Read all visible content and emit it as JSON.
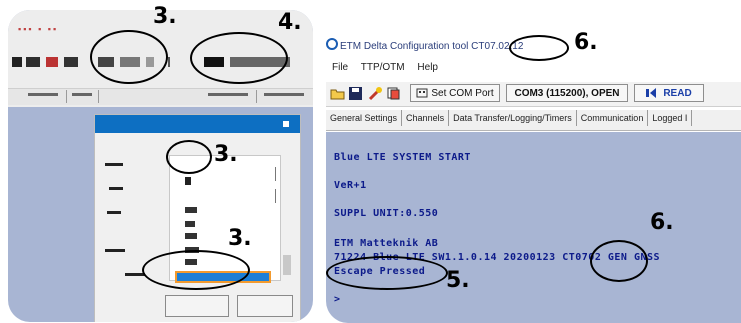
{
  "right_panel": {
    "app_title": "ETM Delta Configuration tool ",
    "app_version": "CT07.02.12",
    "menu": [
      "File",
      "TTP/OTM",
      "Help"
    ],
    "toolbar": {
      "set_port_label": "Set COM Port",
      "port_status": "COM3 (115200), OPEN",
      "read_label": "READ"
    },
    "tabs": [
      "General Settings",
      "Channels",
      "Data Transfer/Logging/Timers",
      "Communication",
      "Logged I"
    ],
    "console": {
      "lines": [
        "Blue LTE SYSTEM START",
        "VeR+1",
        "SUPPL UNIT:0.550",
        "ETM Matteknik AB",
        "71224 Blue LTE SW1.1.0.14 20200123 CT0702 GEN GNSS",
        "Escape Pressed",
        ">"
      ]
    }
  },
  "annotations": {
    "three": "3.",
    "four": "4.",
    "five": "5.",
    "six": "6."
  },
  "colors": {
    "console_bg": "#a8b5d3",
    "console_text": "#0c1a8a",
    "selection": "#1c7ed6",
    "selection_border": "#f29a2e"
  }
}
